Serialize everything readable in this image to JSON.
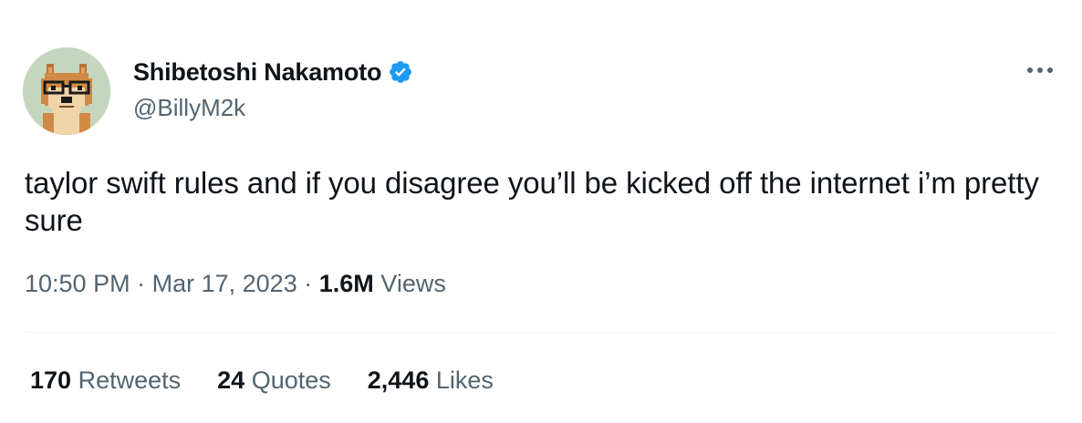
{
  "author": {
    "display_name": "Shibetoshi Nakamoto",
    "handle": "@BillyM2k",
    "verified": true
  },
  "tweet": {
    "text": "taylor swift rules and if you disagree you’ll be kicked off the internet i’m pretty sure",
    "time": "10:50 PM",
    "date": "Mar 17, 2023",
    "views_count": "1.6M",
    "views_label": "Views",
    "separator": "·"
  },
  "stats": {
    "retweets_count": "170",
    "retweets_label": "Retweets",
    "quotes_count": "24",
    "quotes_label": "Quotes",
    "likes_count": "2,446",
    "likes_label": "Likes"
  },
  "icons": {
    "verified": "verified-badge-icon",
    "more": "more-horizontal-icon",
    "avatar": "doge-with-glasses-avatar"
  },
  "colors": {
    "text_primary": "#0f1419",
    "text_secondary": "#536471",
    "verified_blue": "#1d9bf0",
    "divider": "#eff3f4",
    "avatar_bg": "#c5d6bf"
  }
}
